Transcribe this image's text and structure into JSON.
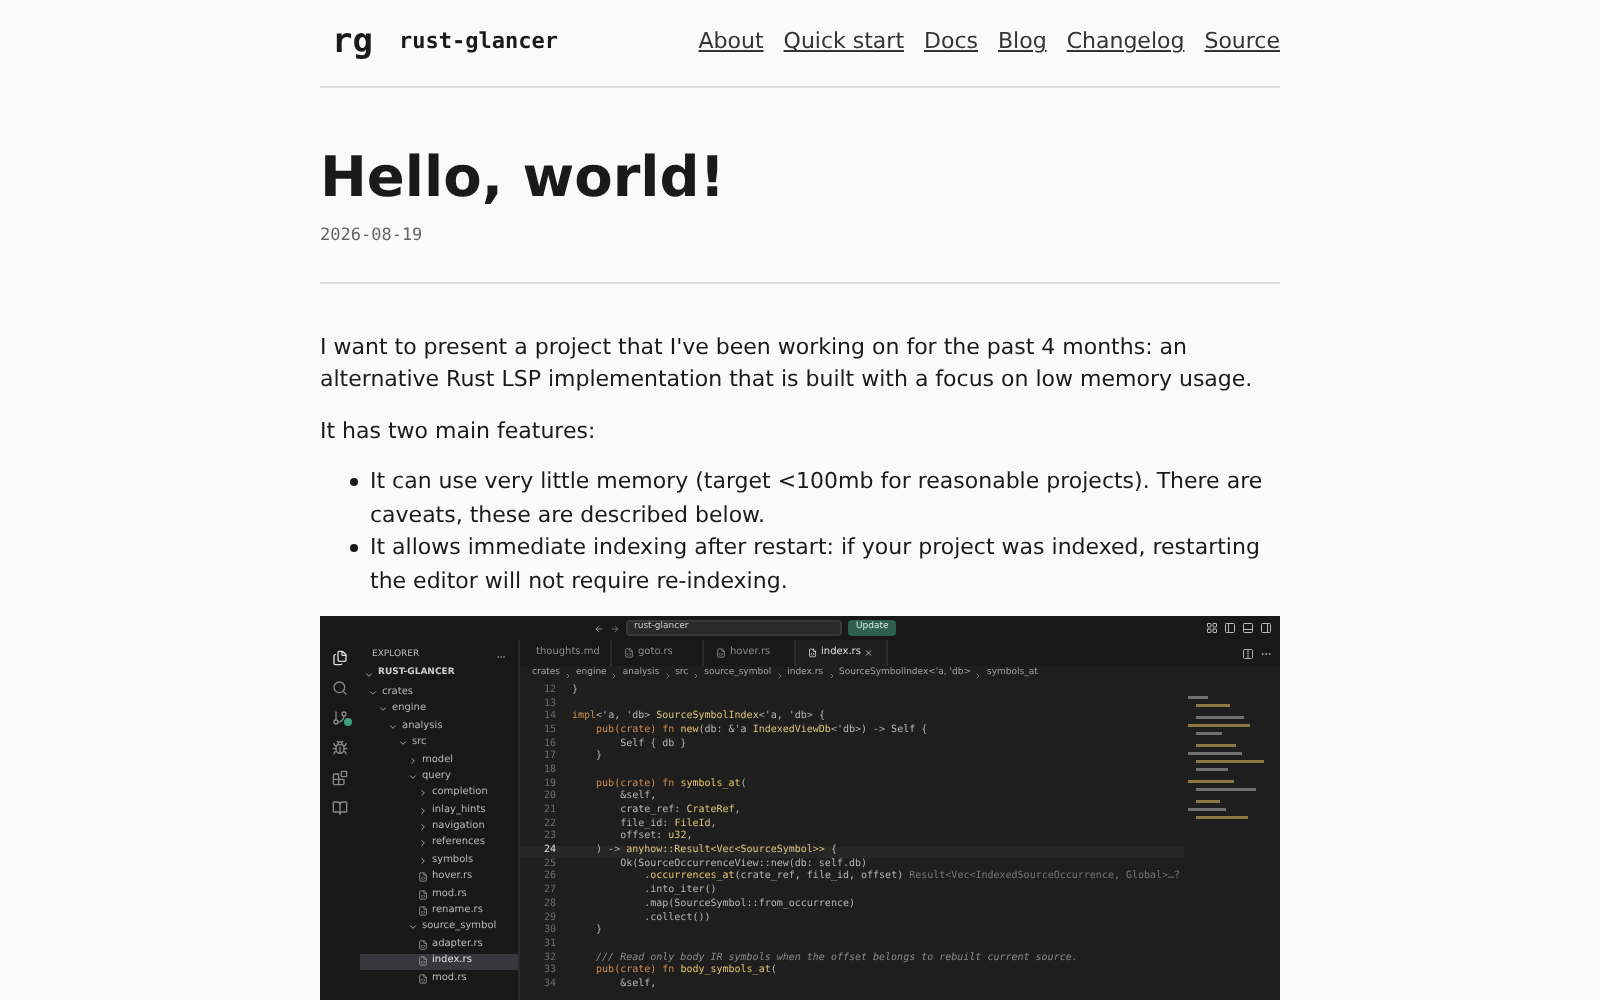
{
  "header": {
    "logo": "rg",
    "site_name": "rust-glancer",
    "nav": [
      {
        "label": "About"
      },
      {
        "label": "Quick start"
      },
      {
        "label": "Docs"
      },
      {
        "label": "Blog"
      },
      {
        "label": "Changelog"
      },
      {
        "label": "Source"
      }
    ]
  },
  "post": {
    "title": "Hello, world!",
    "date": "2026-08-19",
    "paragraphs": [
      "I want to present a project that I've been working on for the past 4 months: an alternative Rust LSP implementation that is built with a focus on low memory usage.",
      "It has two main features:"
    ],
    "bullets": [
      "It can use very little memory (target <100mb for reasonable projects). There are caveats, these are described below.",
      "It allows immediate indexing after restart: if your project was indexed, restarting the editor will not require re-indexing."
    ]
  },
  "editor": {
    "search": "rust-glancer",
    "update_button": "Update",
    "explorer": {
      "title": "EXPLORER",
      "root": "RUST-GLANCER",
      "items": [
        {
          "label": "crates",
          "kind": "folder",
          "expanded": true,
          "selected": false,
          "children": [
            {
              "label": "engine",
              "kind": "folder",
              "expanded": true,
              "selected": false,
              "children": [
                {
                  "label": "analysis",
                  "kind": "folder",
                  "expanded": true,
                  "selected": false,
                  "children": [
                    {
                      "label": "src",
                      "kind": "folder",
                      "expanded": true,
                      "selected": false,
                      "children": [
                        {
                          "label": "model",
                          "kind": "folder",
                          "expanded": false,
                          "selected": false
                        },
                        {
                          "label": "query",
                          "kind": "folder",
                          "expanded": true,
                          "selected": false,
                          "children": [
                            {
                              "label": "completion",
                              "kind": "folder",
                              "expanded": false,
                              "selected": false
                            },
                            {
                              "label": "inlay_hints",
                              "kind": "folder",
                              "expanded": false,
                              "selected": false
                            },
                            {
                              "label": "navigation",
                              "kind": "folder",
                              "expanded": false,
                              "selected": false
                            },
                            {
                              "label": "references",
                              "kind": "folder",
                              "expanded": false,
                              "selected": false
                            },
                            {
                              "label": "symbols",
                              "kind": "folder",
                              "expanded": false,
                              "selected": false
                            },
                            {
                              "label": "hover.rs",
                              "kind": "file",
                              "selected": false
                            },
                            {
                              "label": "mod.rs",
                              "kind": "file",
                              "selected": false
                            },
                            {
                              "label": "rename.rs",
                              "kind": "file",
                              "selected": false
                            }
                          ]
                        },
                        {
                          "label": "source_symbol",
                          "kind": "folder",
                          "expanded": true,
                          "selected": false,
                          "children": [
                            {
                              "label": "adapter.rs",
                              "kind": "file",
                              "selected": false
                            },
                            {
                              "label": "index.rs",
                              "kind": "file",
                              "selected": true
                            },
                            {
                              "label": "mod.rs",
                              "kind": "file",
                              "selected": false
                            }
                          ]
                        }
                      ]
                    }
                  ]
                }
              ]
            }
          ]
        }
      ]
    },
    "tabs": [
      {
        "label": "thoughts.md",
        "kind": "markdown",
        "selected": false
      },
      {
        "label": "goto.rs",
        "kind": "rust",
        "selected": false
      },
      {
        "label": "hover.rs",
        "kind": "rust",
        "selected": false
      },
      {
        "label": "index.rs",
        "kind": "rust",
        "selected": true
      }
    ],
    "breadcrumb": [
      "crates",
      "engine",
      "analysis",
      "src",
      "source_symbol",
      "index.rs",
      "SourceSymbolIndex<'a, 'db>",
      "symbols_at"
    ],
    "code": [
      {
        "number": "12",
        "current": false,
        "segments": [
          {
            "kind": "plain",
            "text": "}"
          }
        ]
      },
      {
        "number": "13",
        "current": false
      },
      {
        "number": "14",
        "current": false,
        "segments": [
          {
            "kind": "kw",
            "text": "impl"
          },
          {
            "kind": "plain",
            "text": "<'a, 'db> "
          },
          {
            "kind": "type",
            "text": "SourceSymbolIndex"
          },
          {
            "kind": "plain",
            "text": "<'a, 'db> {"
          }
        ]
      },
      {
        "number": "15",
        "current": false,
        "segments": [
          {
            "kind": "kw",
            "text": "    pub(crate) fn "
          },
          {
            "kind": "fn",
            "text": "new"
          },
          {
            "kind": "plain",
            "text": "(db: &'a "
          },
          {
            "kind": "type",
            "text": "IndexedViewDb"
          },
          {
            "kind": "plain",
            "text": "<'db>) -> Self {"
          }
        ]
      },
      {
        "number": "16",
        "current": false,
        "segments": [
          {
            "kind": "plain",
            "text": "        Self { db }"
          }
        ]
      },
      {
        "number": "17",
        "current": false,
        "segments": [
          {
            "kind": "plain",
            "text": "    }"
          }
        ]
      },
      {
        "number": "18",
        "current": false
      },
      {
        "number": "19",
        "current": false,
        "segments": [
          {
            "kind": "kw",
            "text": "    pub(crate) fn "
          },
          {
            "kind": "fn",
            "text": "symbols_at"
          },
          {
            "kind": "plain",
            "text": "("
          }
        ]
      },
      {
        "number": "20",
        "current": false,
        "segments": [
          {
            "kind": "plain",
            "text": "        &self,"
          }
        ]
      },
      {
        "number": "21",
        "current": false,
        "segments": [
          {
            "kind": "plain",
            "text": "        crate_ref: "
          },
          {
            "kind": "type",
            "text": "CrateRef"
          },
          {
            "kind": "plain",
            "text": ","
          }
        ]
      },
      {
        "number": "22",
        "current": false,
        "segments": [
          {
            "kind": "plain",
            "text": "        file_id: "
          },
          {
            "kind": "type",
            "text": "FileId"
          },
          {
            "kind": "plain",
            "text": ","
          }
        ]
      },
      {
        "number": "23",
        "current": false,
        "segments": [
          {
            "kind": "plain",
            "text": "        offset: "
          },
          {
            "kind": "type",
            "text": "u32"
          },
          {
            "kind": "plain",
            "text": ","
          }
        ]
      },
      {
        "number": "24",
        "current": true,
        "segments": [
          {
            "kind": "plain",
            "text": "    ) -> "
          },
          {
            "kind": "type",
            "text": "anyhow::Result<Vec<SourceSymbol>>"
          },
          {
            "kind": "plain",
            "text": " {"
          }
        ]
      },
      {
        "number": "25",
        "current": false,
        "segments": [
          {
            "kind": "plain",
            "text": "        Ok(SourceOccurrenceView::new(db: self.db)"
          }
        ]
      },
      {
        "number": "26",
        "current": false,
        "segments": [
          {
            "kind": "plain",
            "text": "            ."
          },
          {
            "kind": "fn",
            "text": "occurrences_at"
          },
          {
            "kind": "plain",
            "text": "(crate_ref, file_id, offset) "
          },
          {
            "kind": "hint",
            "text": "Result<Vec<IndexedSourceOccurrence, Global>…?"
          }
        ]
      },
      {
        "number": "27",
        "current": false,
        "segments": [
          {
            "kind": "plain",
            "text": "            .into_iter()"
          }
        ]
      },
      {
        "number": "28",
        "current": false,
        "segments": [
          {
            "kind": "plain",
            "text": "            .map(SourceSymbol::from_occurrence)"
          }
        ]
      },
      {
        "number": "29",
        "current": false,
        "segments": [
          {
            "kind": "plain",
            "text": "            .collect())"
          }
        ]
      },
      {
        "number": "30",
        "current": false,
        "segments": [
          {
            "kind": "plain",
            "text": "    }"
          }
        ]
      },
      {
        "number": "31",
        "current": false
      },
      {
        "number": "32",
        "current": false,
        "segments": [
          {
            "kind": "comment",
            "text": "    /// Read only body IR symbols when the offset belongs to rebuilt current source."
          }
        ]
      },
      {
        "number": "33",
        "current": false,
        "segments": [
          {
            "kind": "kw",
            "text": "    pub(crate) fn "
          },
          {
            "kind": "fn",
            "text": "body_symbols_at"
          },
          {
            "kind": "plain",
            "text": "("
          }
        ]
      },
      {
        "number": "34",
        "current": false,
        "segments": [
          {
            "kind": "plain",
            "text": "        &self,"
          }
        ]
      }
    ]
  }
}
